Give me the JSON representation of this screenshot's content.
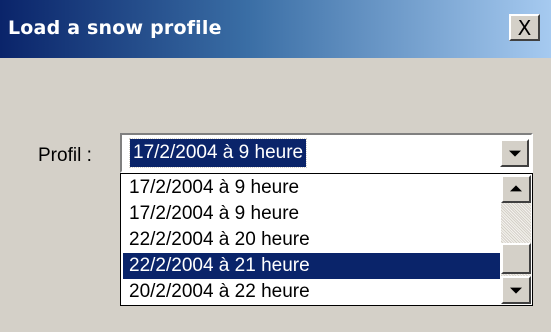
{
  "window": {
    "title": "Load a snow profile",
    "close_symbol": "X"
  },
  "form": {
    "profile_label": "Profil :",
    "selected_value": "17/2/2004 à 9 heure"
  },
  "dropdown": {
    "items": [
      {
        "label": "17/2/2004 à 9 heure",
        "selected": false
      },
      {
        "label": "17/2/2004 à 9 heure",
        "selected": false
      },
      {
        "label": "22/2/2004 à 20 heure",
        "selected": false
      },
      {
        "label": "22/2/2004 à 21 heure",
        "selected": true
      },
      {
        "label": "20/2/2004 à 22 heure",
        "selected": false
      }
    ]
  },
  "icons": {
    "close": "close-icon",
    "combo_arrow": "chevron-down-icon",
    "scroll_up": "scroll-up-icon",
    "scroll_down": "scroll-down-icon"
  },
  "colors": {
    "titlebar_start": "#0a246a",
    "titlebar_end": "#a6caf0",
    "selection": "#0a246a",
    "face": "#d4d0c8"
  }
}
